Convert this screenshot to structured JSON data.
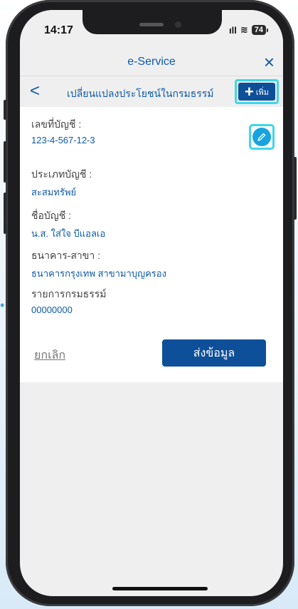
{
  "status": {
    "time": "14:17",
    "signal": "ıll",
    "wifi": "≋",
    "battery": "74"
  },
  "app": {
    "title": "e-Service",
    "close_icon": "×"
  },
  "subheader": {
    "back_icon": "<",
    "title": "เปลี่ยนแปลงประโยชน์ในกรมธรรม์",
    "add_label": "เพิ่ม",
    "add_icon": "+"
  },
  "fields": [
    {
      "label": "เลขที่บัญชี :",
      "value": "123-4-567-12-3"
    },
    {
      "label": "ประเภทบัญชี :",
      "value": "สะสมทรัพย์"
    },
    {
      "label": "ชื่อบัญชี :",
      "value": "น.ส. ใส่ใจ บีแอลเอ"
    },
    {
      "label": "ธนาคาร-สาขา :",
      "value": "ธนาคารกรุงเทพ สาขามาบุญครอง"
    },
    {
      "label": "รายการกรมธรรม์",
      "value": "00000000"
    }
  ],
  "actions": {
    "cancel": "ยกเลิก",
    "submit": "ส่งข้อมูล"
  },
  "colors": {
    "primary": "#0e4f99",
    "link": "#0e5ba8",
    "highlight": "#3fd6e8",
    "edit": "#17a3e0"
  }
}
